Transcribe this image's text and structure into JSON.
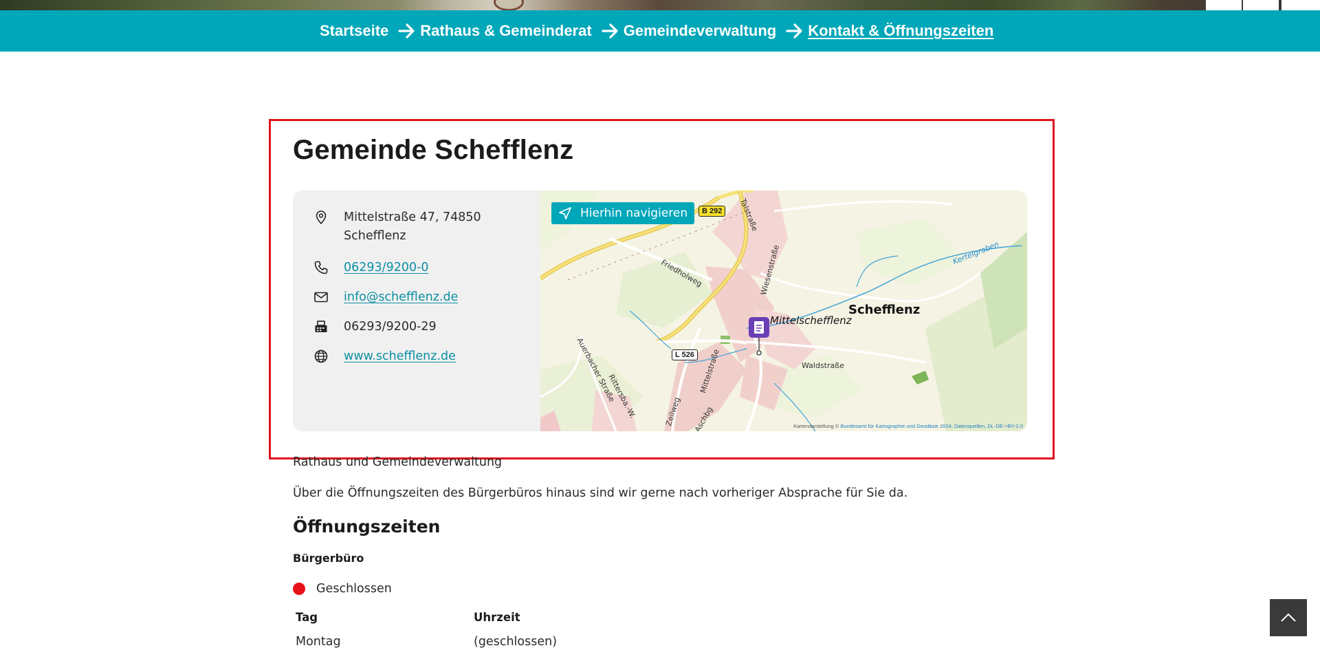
{
  "breadcrumb": {
    "items": [
      "Startseite",
      "Rathaus & Gemeinderat",
      "Gemeindeverwaltung",
      "Kontakt & Öffnungszeiten"
    ]
  },
  "contact_card": {
    "title": "Gemeinde Schefflenz",
    "address_line1": "Mittelstraße 47, 74850",
    "address_line2": "Schefflenz",
    "phone": "06293/9200-0",
    "email": "info@schefflenz.de",
    "fax": "06293/9200-29",
    "website": "www.schefflenz.de",
    "icons": [
      "location-pin-icon",
      "phone-icon",
      "mail-icon",
      "fax-icon",
      "globe-icon"
    ]
  },
  "map": {
    "navigate_label": "Hierhin navigieren",
    "place_label": "Schefflenz",
    "marker_label": "Mittelschefflenz",
    "road_labels": {
      "b292": "B 292",
      "l526": "L 526",
      "talstrasse": "Talstraße",
      "friedholweg": "Friedholweg",
      "wiesenstrasse": "Wiesenstraße",
      "kertelgraben": "Kertelgraben",
      "waldstrasse": "Waldstraße",
      "auerbacher": "Auerbacher Straße",
      "rittersbach": "Rittersba.-W.",
      "mittelstrasse": "Mittelstraße",
      "zeilweg": "Zeilweg",
      "aschbg": "Aschbg"
    },
    "credit_prefix": "Kartendarstellung ©",
    "credit_link": "Bundesamt für Kartographie und Geodäsie 2024, Datenquellen, DL-DE->BY-2.0"
  },
  "content": {
    "subtitle": "Rathaus und Gemeindeverwaltung",
    "intro": "Über die Öffnungszeiten des Bürgerbüros hinaus sind wir gerne nach vorheriger Absprache für Sie da.",
    "hours_heading": "Öffnungszeiten",
    "office_heading": "Bürgerbüro",
    "status_label": "Geschlossen",
    "table": {
      "headers": [
        "Tag",
        "Uhrzeit"
      ],
      "rows": [
        [
          "Montag",
          "(geschlossen)"
        ]
      ]
    }
  },
  "colors": {
    "brand": "#00a7b9",
    "highlight": "#e0141c",
    "status_closed": "#e8131a",
    "link": "#0b8fa3"
  }
}
